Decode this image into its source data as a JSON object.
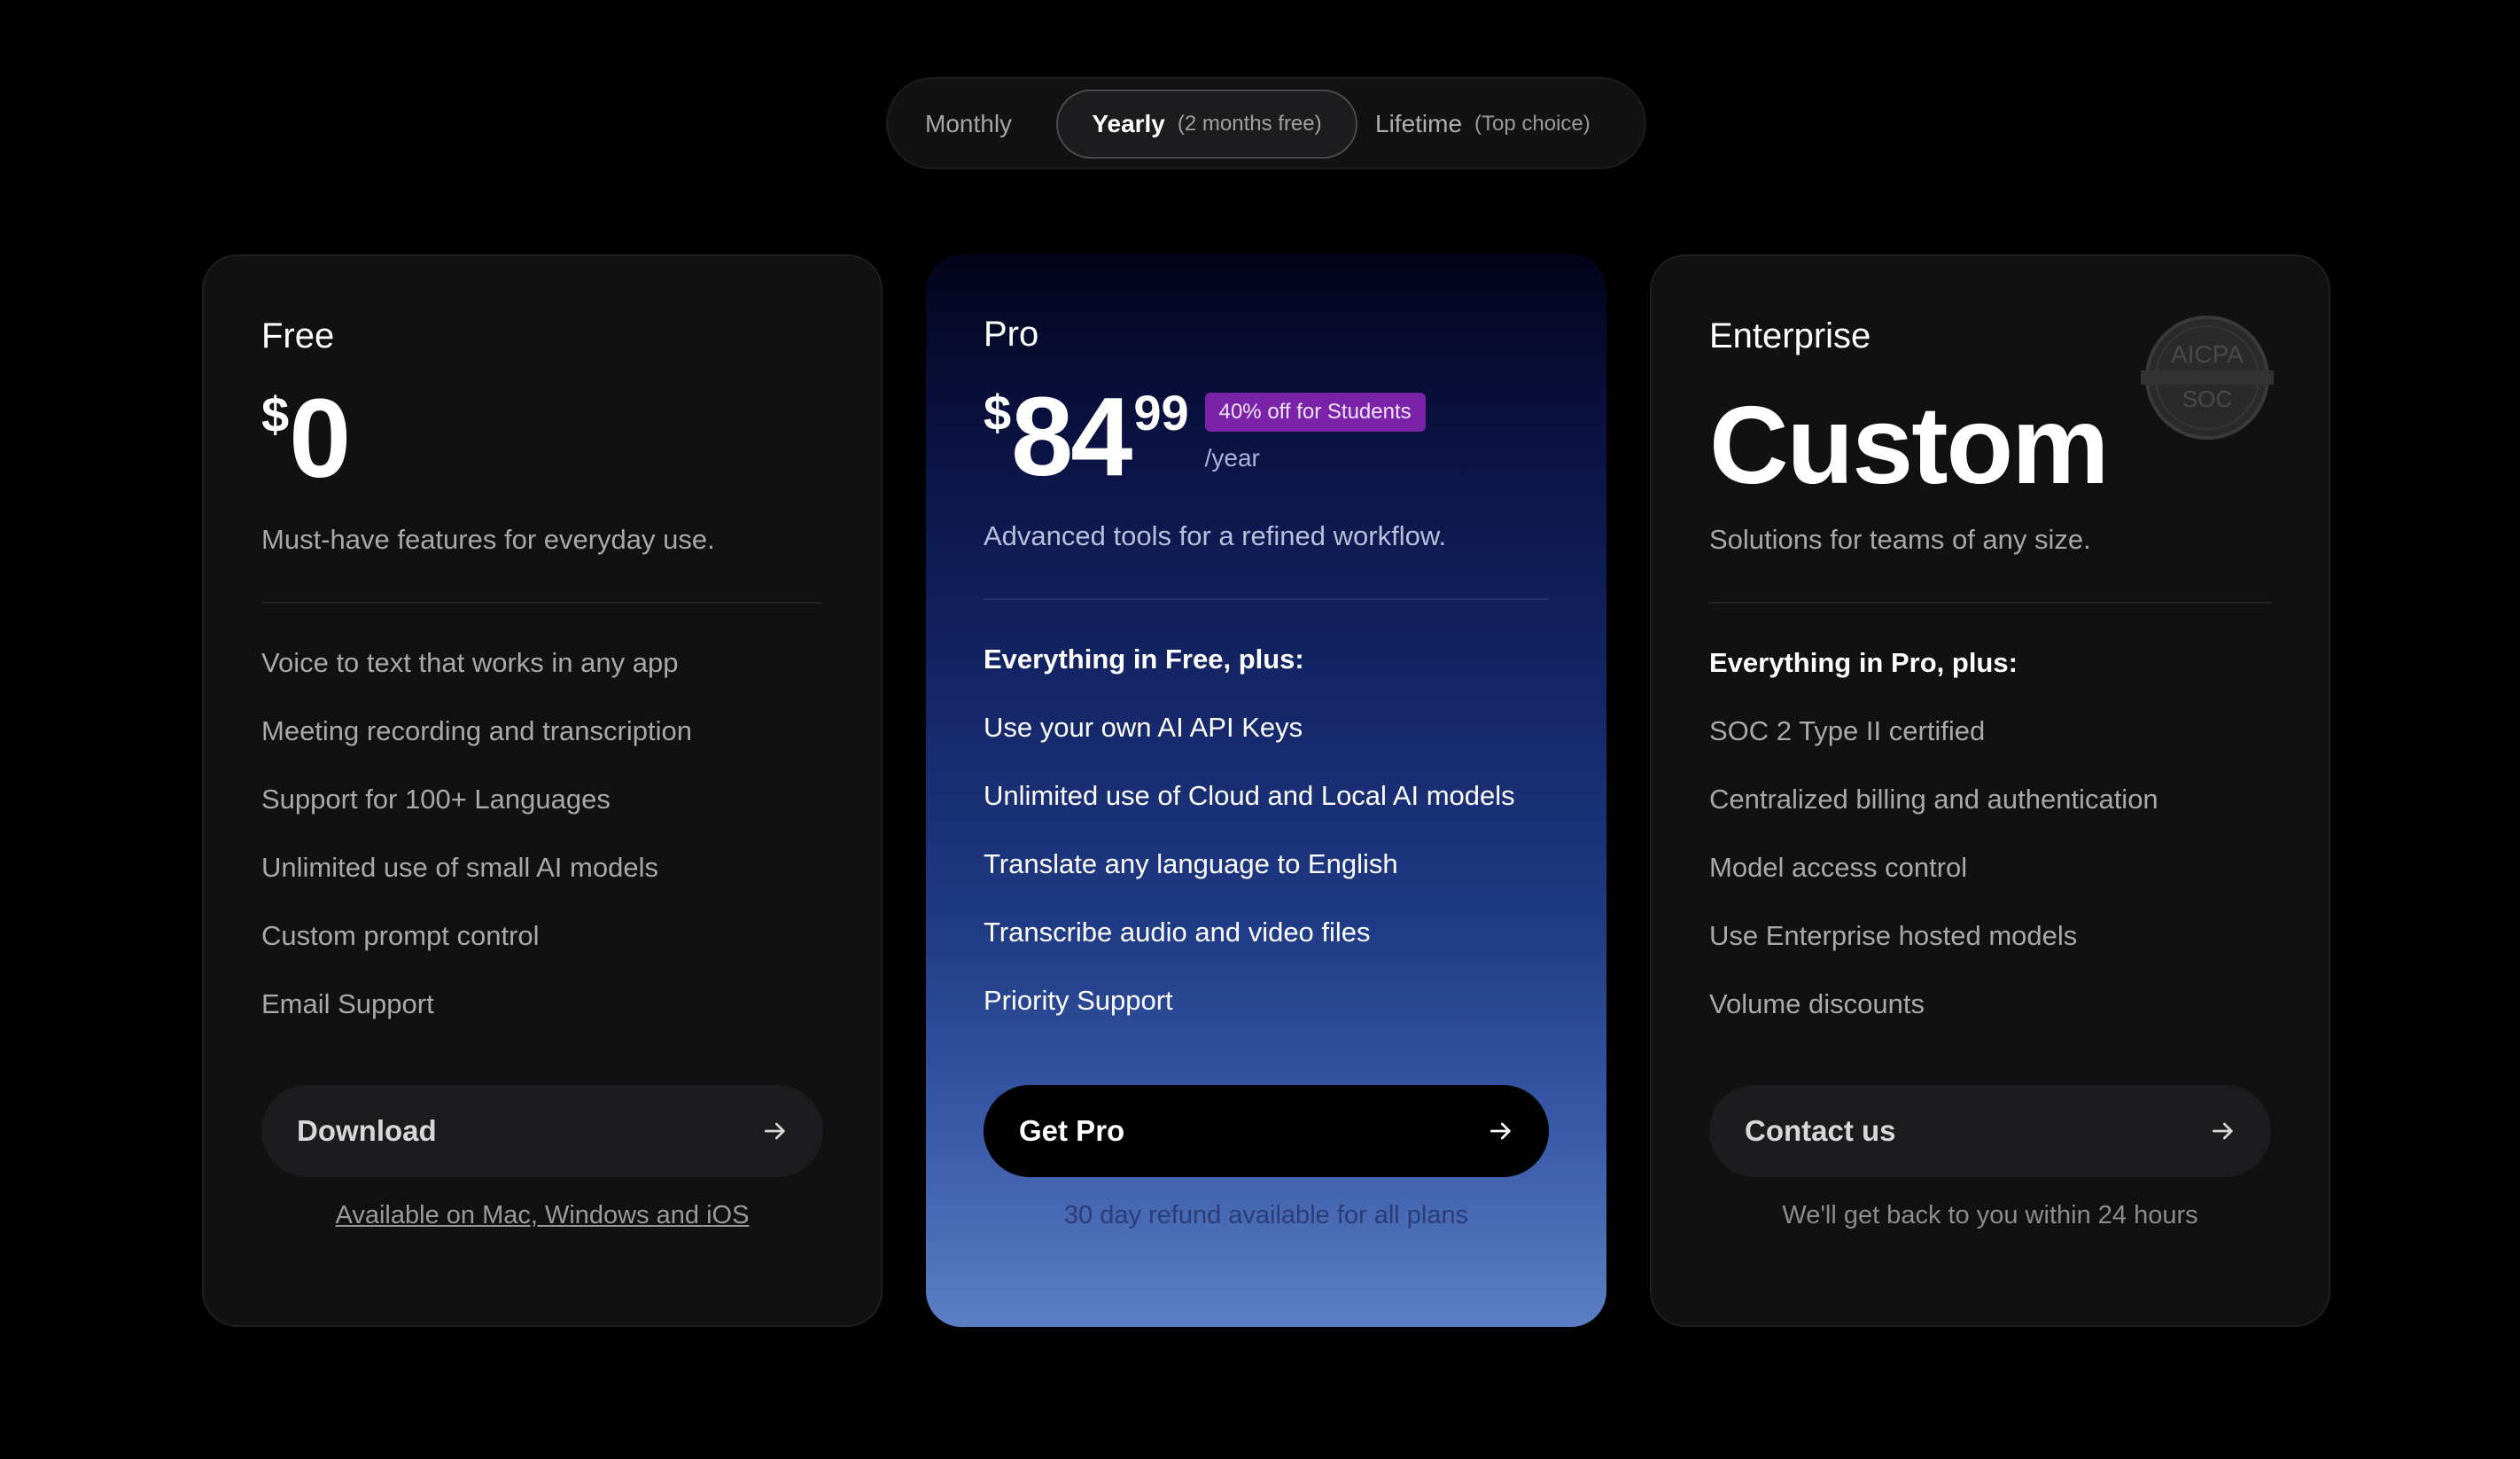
{
  "billing_toggle": {
    "options": [
      {
        "label": "Monthly",
        "note": ""
      },
      {
        "label": "Yearly",
        "note": "(2 months free)"
      },
      {
        "label": "Lifetime",
        "note": "(Top choice)"
      }
    ],
    "selected": "Yearly"
  },
  "plans": {
    "free": {
      "name": "Free",
      "currency": "$",
      "price": "0",
      "description": "Must-have features for everyday use.",
      "features": [
        "Voice to text that works in any app",
        "Meeting recording and transcription",
        "Support for 100+ Languages",
        "Unlimited use of small AI models",
        "Custom prompt control",
        "Email Support"
      ],
      "cta_label": "Download",
      "footnote": "Available on Mac, Windows and iOS"
    },
    "pro": {
      "name": "Pro",
      "currency": "$",
      "price": "84",
      "cents": "99",
      "badge": "40% off for Students",
      "period": "/year",
      "description": "Advanced tools for a refined workflow.",
      "features_lead": "Everything in Free, plus:",
      "features": [
        "Use your own AI API Keys",
        "Unlimited use of Cloud and Local AI models",
        "Translate any language to English",
        "Transcribe audio and video files",
        "Priority Support"
      ],
      "cta_label": "Get Pro",
      "footnote": "30 day refund available for all plans"
    },
    "enterprise": {
      "name": "Enterprise",
      "price": "Custom",
      "description": "Solutions for teams of any size.",
      "badge_text_top": "AICPA",
      "badge_text_bottom": "SOC",
      "features_lead": "Everything in Pro, plus:",
      "features": [
        "SOC 2 Type II certified",
        "Centralized billing and authentication",
        "Model access control",
        "Use Enterprise hosted models",
        "Volume discounts"
      ],
      "cta_label": "Contact us",
      "footnote": "We'll get back to you within 24 hours"
    }
  },
  "colors": {
    "background": "#000000",
    "card": "#111111",
    "pro_gradient_top": "#03031a",
    "pro_gradient_bottom": "#5b7fc4",
    "student_badge": "#7a23a8"
  },
  "icons": {
    "cta_arrow": "arrow-right-icon",
    "soc_badge": "aicpa-soc-badge"
  }
}
